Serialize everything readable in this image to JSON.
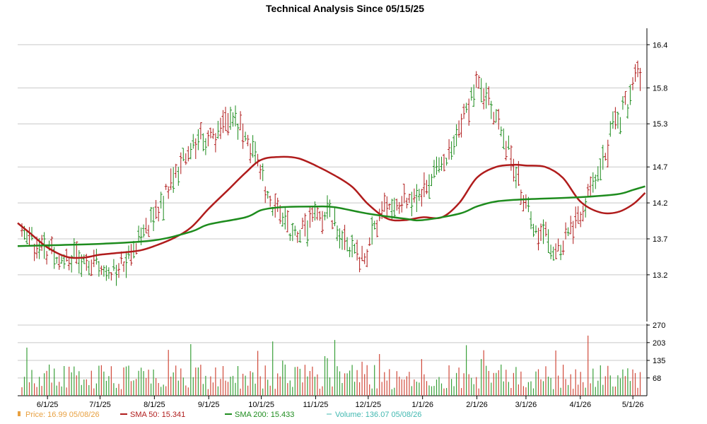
{
  "chart_data": {
    "type": "line",
    "title": "Technical Analysis Since 05/15/25",
    "price_axis": {
      "ticks": [
        "16.4",
        "15.8",
        "15.3",
        "14.7",
        "14.2",
        "13.7",
        "13.2"
      ],
      "tick_values": [
        16.4,
        15.8,
        15.3,
        14.7,
        14.2,
        13.7,
        13.2
      ],
      "ylim": [
        12.55,
        16.55
      ]
    },
    "volume_axis": {
      "ticks": [
        "270",
        "203",
        "135",
        "68"
      ],
      "tick_values": [
        270,
        203,
        135,
        68
      ],
      "ylim": [
        0,
        270
      ]
    },
    "x_ticks": [
      "6/1/25",
      "7/1/25",
      "8/1/25",
      "9/1/25",
      "10/1/25",
      "11/1/25",
      "12/1/25",
      "1/1/26",
      "2/1/26",
      "3/1/26",
      "4/1/26",
      "5/1/26"
    ],
    "series": [
      {
        "name": "SMA 50",
        "color": "#b01c1c",
        "x": [
          "5/15/25",
          "5/22/25",
          "6/1/25",
          "6/12/25",
          "6/22/25",
          "7/1/25",
          "7/14/25",
          "7/24/25",
          "8/1/25",
          "8/12/25",
          "8/22/25",
          "9/1/25",
          "9/12/25",
          "9/22/25",
          "10/1/25",
          "10/12/25",
          "10/22/25",
          "11/1/25",
          "11/12/25",
          "11/22/25",
          "12/1/25",
          "12/12/25",
          "12/22/25",
          "1/1/26",
          "1/12/26",
          "1/22/26",
          "2/1/26",
          "2/12/26",
          "2/22/26",
          "3/1/26",
          "3/12/26",
          "3/22/26",
          "4/1/26",
          "4/12/26",
          "4/22/26",
          "5/1/26",
          "5/8/26"
        ],
        "values": [
          13.92,
          13.78,
          13.58,
          13.45,
          13.44,
          13.48,
          13.51,
          13.54,
          13.6,
          13.71,
          13.86,
          14.12,
          14.38,
          14.62,
          14.8,
          14.84,
          14.82,
          14.72,
          14.58,
          14.42,
          14.18,
          13.98,
          13.96,
          14.0,
          14.0,
          14.2,
          14.55,
          14.7,
          14.73,
          14.72,
          14.7,
          14.55,
          14.22,
          14.07,
          14.07,
          14.18,
          14.34
        ]
      },
      {
        "name": "SMA 200",
        "color": "#1e8c1e",
        "x": [
          "5/15/25",
          "6/1/25",
          "7/1/25",
          "8/1/25",
          "8/22/25",
          "9/1/25",
          "9/22/25",
          "10/1/25",
          "10/12/25",
          "11/1/25",
          "11/12/25",
          "12/1/25",
          "12/22/25",
          "1/1/26",
          "1/22/26",
          "2/1/26",
          "2/12/26",
          "3/1/26",
          "4/1/26",
          "4/22/26",
          "5/1/26",
          "5/8/26"
        ],
        "values": [
          13.6,
          13.61,
          13.63,
          13.68,
          13.8,
          13.9,
          14.0,
          14.1,
          14.14,
          14.15,
          14.14,
          14.05,
          13.98,
          13.96,
          14.05,
          14.15,
          14.22,
          14.25,
          14.28,
          14.32,
          14.38,
          14.43
        ]
      }
    ],
    "legend": {
      "position": "bottom",
      "items": [
        {
          "text": "Price: 16.99  05/08/26",
          "color": "#e8a040"
        },
        {
          "text": "SMA 50: 15.341",
          "color": "#b01c1c"
        },
        {
          "text": "SMA 200: 15.433",
          "color": "#1e8c1e"
        },
        {
          "text": "Volume: 136.07  05/08/26",
          "color": "#40b8b0"
        }
      ]
    },
    "price_color_up": "#1e8c1e",
    "price_color_down": "#b01c1c",
    "grid": true
  }
}
